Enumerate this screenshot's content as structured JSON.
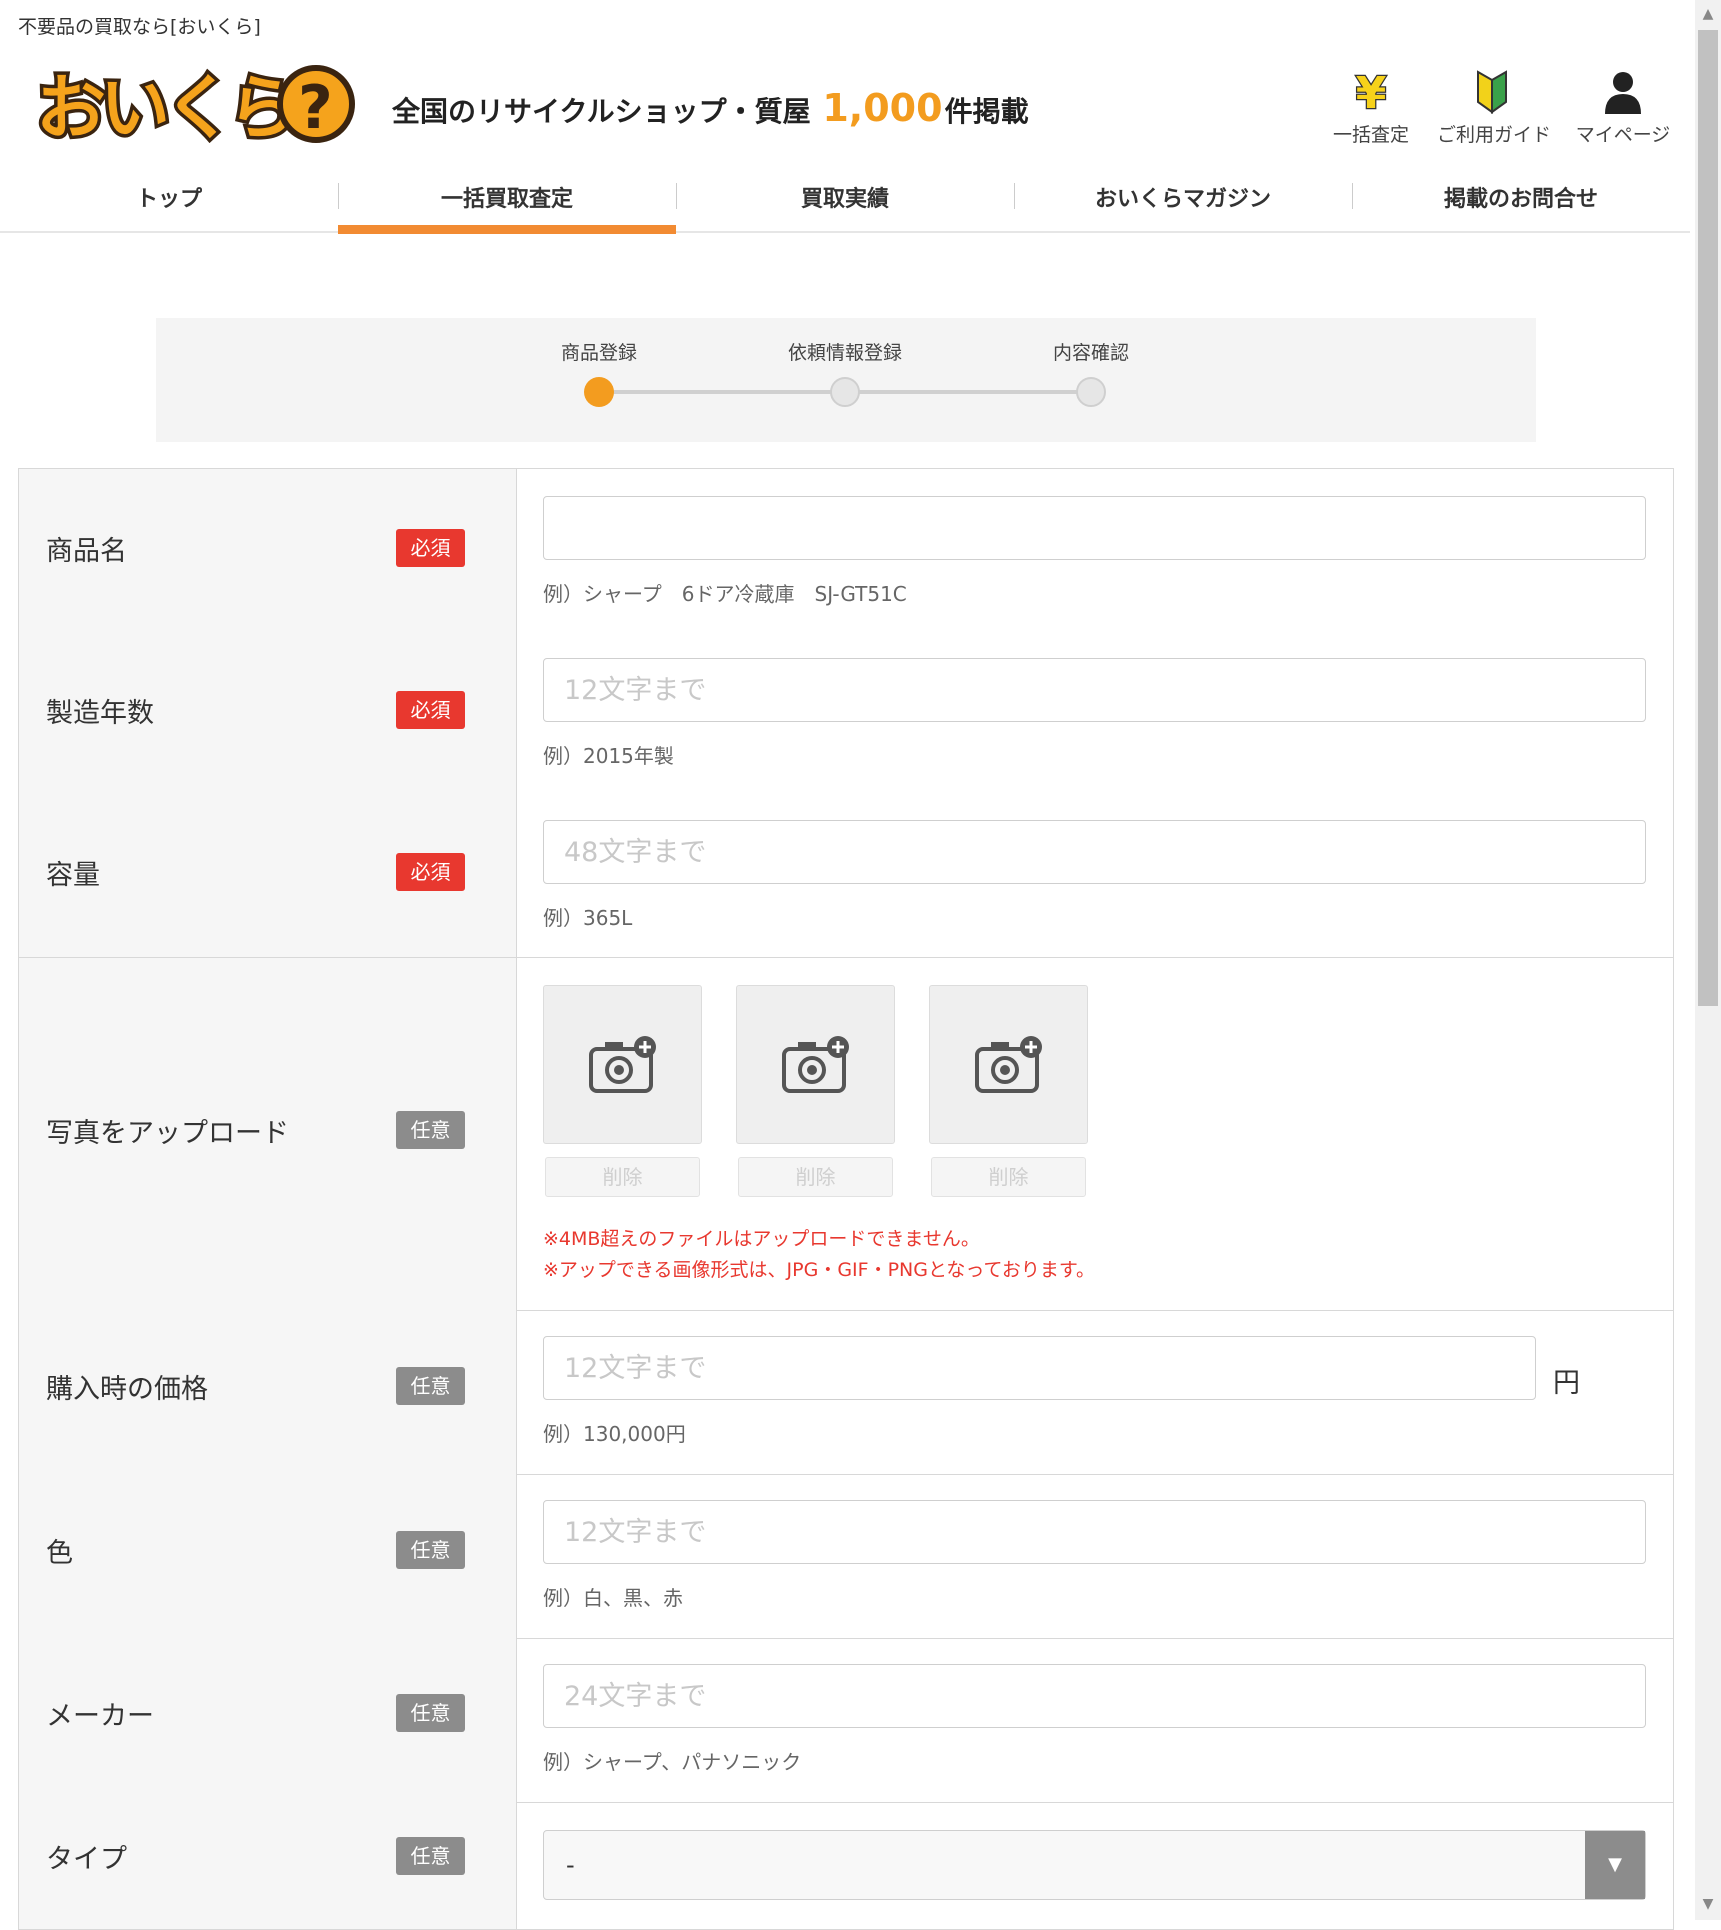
{
  "header": {
    "tagline": "不要品の買取なら[おいくら]",
    "logo_text": "おいくら?",
    "catch_prefix": "全国のリサイクルショップ・質屋",
    "catch_number": "1,000",
    "catch_suffix": "件掲載",
    "icons": [
      {
        "label": "一括査定",
        "icon": "yen-icon"
      },
      {
        "label": "ご利用ガイド",
        "icon": "beginner-leaf-icon"
      },
      {
        "label": "マイページ",
        "icon": "user-icon"
      }
    ]
  },
  "nav": {
    "tabs": [
      {
        "label": "トップ",
        "active": false
      },
      {
        "label": "一括買取査定",
        "active": true
      },
      {
        "label": "買取実績",
        "active": false
      },
      {
        "label": "おいくらマガジン",
        "active": false
      },
      {
        "label": "掲載のお問合せ",
        "active": false
      }
    ]
  },
  "steps": [
    {
      "label": "商品登録",
      "current": true
    },
    {
      "label": "依頼情報登録",
      "current": false
    },
    {
      "label": "内容確認",
      "current": false
    }
  ],
  "form": {
    "product_name": {
      "label": "商品名",
      "badge": "必須",
      "value": "",
      "placeholder": "",
      "hint": "例）シャープ　6ドア冷蔵庫　SJ-GT51C"
    },
    "year": {
      "label": "製造年数",
      "badge": "必須",
      "value": "",
      "placeholder": "12文字まで",
      "hint": "例）2015年製"
    },
    "capacity": {
      "label": "容量",
      "badge": "必須",
      "value": "",
      "placeholder": "48文字まで",
      "hint": "例）365L"
    },
    "photos": {
      "label": "写真をアップロード",
      "badge": "任意",
      "delete_label": "削除",
      "warnings": [
        "※4MB超えのファイルはアップロードできません。",
        "※アップできる画像形式は、JPG・GIF・PNGとなっております。"
      ]
    },
    "price": {
      "label": "購入時の価格",
      "badge": "任意",
      "value": "",
      "placeholder": "12文字まで",
      "unit": "円",
      "hint": "例）130,000円"
    },
    "color": {
      "label": "色",
      "badge": "任意",
      "value": "",
      "placeholder": "12文字まで",
      "hint": "例）白、黒、赤"
    },
    "maker": {
      "label": "メーカー",
      "badge": "任意",
      "value": "",
      "placeholder": "24文字まで",
      "hint": "例）シャープ、パナソニック"
    },
    "type": {
      "label": "タイプ",
      "badge": "任意",
      "selected": "-"
    }
  },
  "colors": {
    "accent_orange": "#f39c1f",
    "required_red": "#e8382f",
    "optional_gray": "#8c8c8c"
  }
}
